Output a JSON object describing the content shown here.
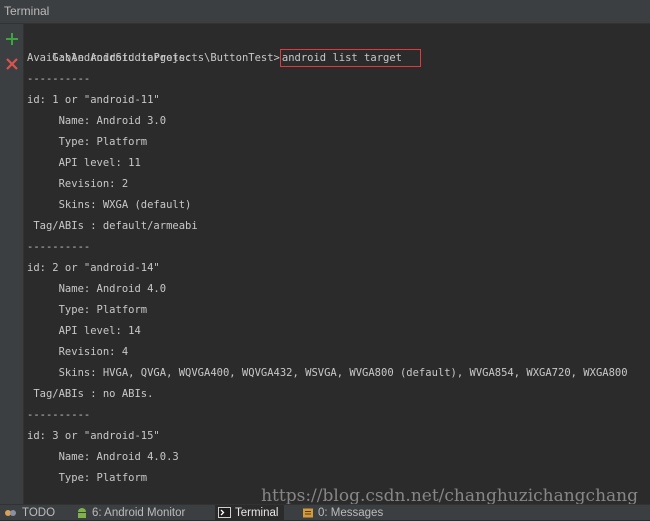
{
  "window": {
    "title": "Terminal"
  },
  "sidebar": {
    "buttons": [
      {
        "icon": "plus-icon",
        "label": "New Session",
        "color": "#3fa33f"
      },
      {
        "icon": "close-icon",
        "label": "Close Session",
        "color": "#d9534f"
      }
    ]
  },
  "terminal": {
    "prompt": "G:\\AndroidStudioProjects\\ButtonTest>",
    "command": "android list target",
    "command_highlight_color": "#e0393e",
    "lines": [
      "Available Android targets:",
      "----------",
      "id: 1 or \"android-11\"",
      "     Name: Android 3.0",
      "     Type: Platform",
      "     API level: 11",
      "     Revision: 2",
      "     Skins: WXGA (default)",
      " Tag/ABIs : default/armeabi",
      "----------",
      "id: 2 or \"android-14\"",
      "     Name: Android 4.0",
      "     Type: Platform",
      "     API level: 14",
      "     Revision: 4",
      "     Skins: HVGA, QVGA, WQVGA400, WQVGA432, WSVGA, WVGA800 (default), WVGA854, WXGA720, WXGA800",
      " Tag/ABIs : no ABIs.",
      "----------",
      "id: 3 or \"android-15\"",
      "     Name: Android 4.0.3",
      "     Type: Platform"
    ]
  },
  "watermark": "https://blog.csdn.net/changhuzichangchang",
  "statusbar": {
    "tabs": [
      {
        "label": "TODO",
        "icon": "todo-icon",
        "active": false
      },
      {
        "label": "6: Android Monitor",
        "icon": "android-icon",
        "active": false
      },
      {
        "label": "Terminal",
        "icon": "terminal-icon",
        "active": true
      },
      {
        "label": "0: Messages",
        "icon": "messages-icon",
        "active": false
      }
    ]
  }
}
